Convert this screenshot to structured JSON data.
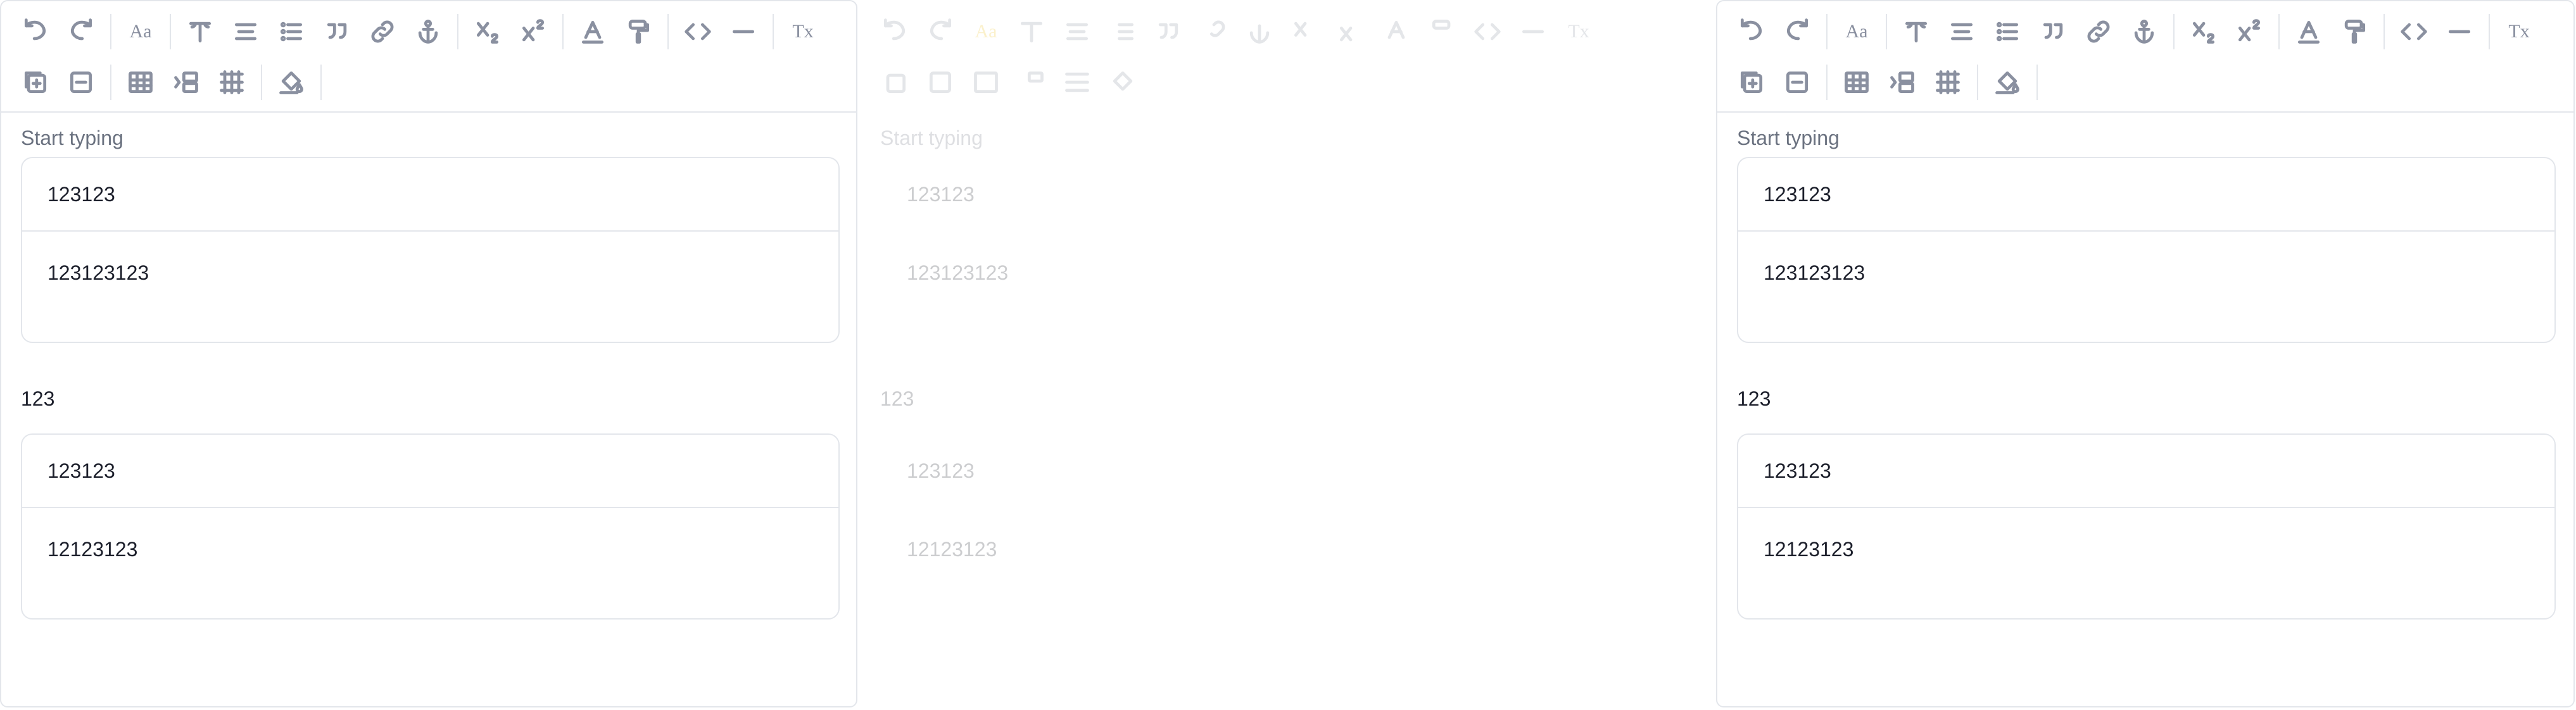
{
  "editor_panels": [
    {
      "placeholder": "Start typing",
      "table1": {
        "row1": "123123",
        "row2": "123123123"
      },
      "paragraph": "123",
      "table2": {
        "row1": "123123",
        "row2": "12123123"
      }
    },
    {
      "placeholder": "Start typing",
      "table1": {
        "row1": "123123",
        "row2": "123123123"
      },
      "paragraph": "123",
      "table2": {
        "row1": "123123",
        "row2": "12123123"
      }
    },
    {
      "placeholder": "Start typing",
      "table1": {
        "row1": "123123",
        "row2": "123123123"
      },
      "paragraph": "123",
      "table2": {
        "row1": "123123",
        "row2": "12123123"
      }
    }
  ],
  "toolbar": {
    "font_size_text": "Aa",
    "clear_format_text": "Tx"
  },
  "colors": {
    "border": "#e3e6eb",
    "icon": "#8a90a0",
    "text": "#1c1f2b",
    "muted_text": "#6b7280",
    "highlight": "#f1c21b"
  }
}
